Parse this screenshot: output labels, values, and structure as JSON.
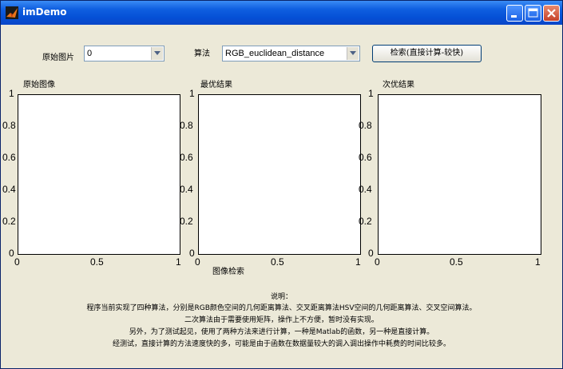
{
  "window": {
    "title": "imDemo"
  },
  "controls": {
    "source_label": "原始图片",
    "source_value": "0",
    "algo_label": "算法",
    "algo_value": "RGB_euclidean_distance",
    "search_button": "检索(直接计算-较快)"
  },
  "panels": [
    {
      "title": "原始图像",
      "yticks": [
        "1",
        "0.8",
        "0.6",
        "0.4",
        "0.2",
        "0"
      ],
      "xticks": [
        "0",
        "0.5",
        "1"
      ]
    },
    {
      "title": "最优结果",
      "yticks": [
        "1",
        "0.8",
        "0.6",
        "0.4",
        "0.2",
        "0"
      ],
      "xticks": [
        "0",
        "0.5",
        "1"
      ]
    },
    {
      "title": "次优结果",
      "yticks": [
        "1",
        "0.8",
        "0.6",
        "0.4",
        "0.2",
        "0"
      ],
      "xticks": [
        "0",
        "0.5",
        "1"
      ]
    }
  ],
  "section_label": "图像检索",
  "description": {
    "heading": "说明：",
    "lines": [
      "程序当前实现了四种算法，分别是RGB颜色空间的几何距离算法、交叉距离算法HSV空间的几何距离算法、交叉空间算法。",
      "二次算法由于需要使用矩阵，操作上不方便，暂时没有实现。",
      "另外，为了测试起见，使用了两种方法来进行计算，一种是Matlab的函数，另一种是直接计算。",
      "经测试，直接计算的方法速度快的多，可能是由于函数在数据量较大的调入调出操作中耗费的时间比较多。"
    ]
  },
  "colors": {
    "titlebar": "#0550d6",
    "face": "#ece9d8",
    "close": "#c5422a"
  },
  "icons": {
    "app": "matlab-icon",
    "minimize": "minimize-icon",
    "maximize": "maximize-icon",
    "close": "close-icon"
  }
}
